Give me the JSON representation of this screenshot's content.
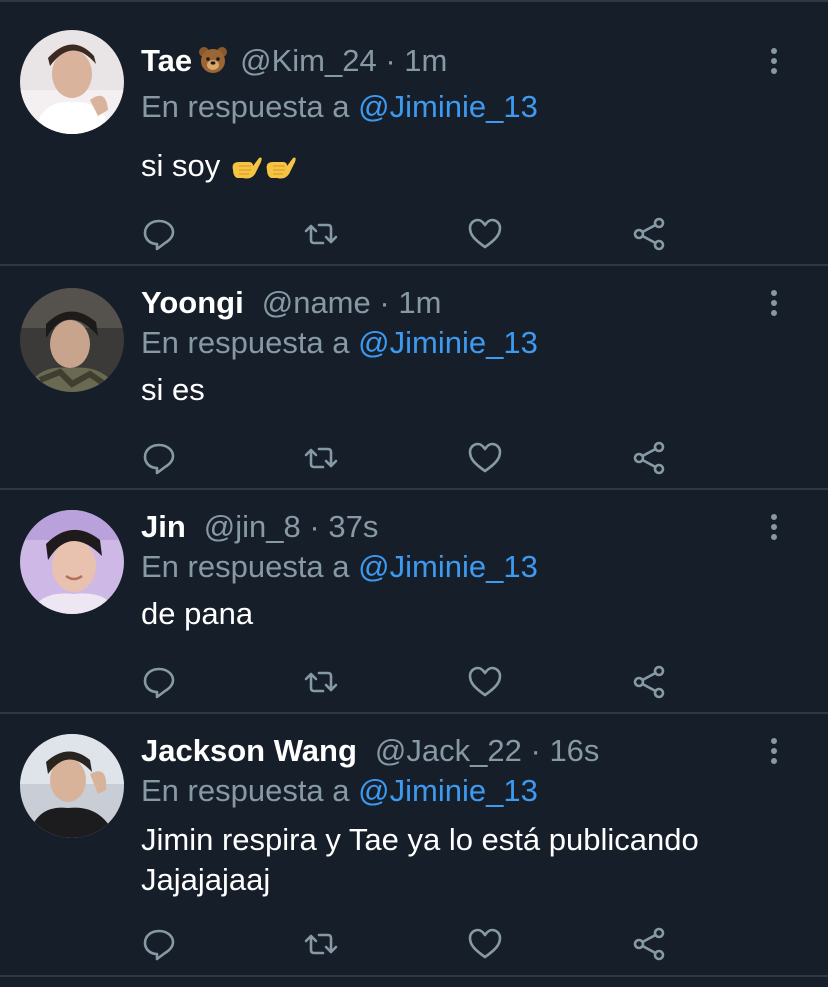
{
  "tweets": [
    {
      "display_name": "Tae",
      "name_emoji": "bear-face-icon",
      "handle": "@Kim_24",
      "separator": "·",
      "time": "1m",
      "reply_prefix": "En respuesta a",
      "reply_to": "@Jiminie_13",
      "text": "si soy",
      "text_emoji": "call-me-hand-icon x2"
    },
    {
      "display_name": "Yoongi",
      "handle": "@name",
      "separator": "·",
      "time": "1m",
      "reply_prefix": "En respuesta a",
      "reply_to": "@Jiminie_13",
      "text": "si es"
    },
    {
      "display_name": "Jin",
      "handle": "@jin_8",
      "separator": "·",
      "time": "37s",
      "reply_prefix": "En respuesta a",
      "reply_to": "@Jiminie_13",
      "text": "de pana"
    },
    {
      "display_name": "Jackson Wang",
      "handle": "@Jack_22",
      "separator": "·",
      "time": "16s",
      "reply_prefix": "En respuesta a",
      "reply_to": "@Jiminie_13",
      "text_line1": "Jimin respira y Tae ya lo está publicando",
      "text_line2": "Jajajajaaj"
    }
  ],
  "action_icons": [
    "reply-icon",
    "retweet-icon",
    "like-icon",
    "share-icon"
  ],
  "colors": {
    "background": "#151e29",
    "divider": "#2f3844",
    "secondary_text": "#8899a6",
    "mention": "#3d9af0",
    "primary_text": "#ffffff"
  }
}
